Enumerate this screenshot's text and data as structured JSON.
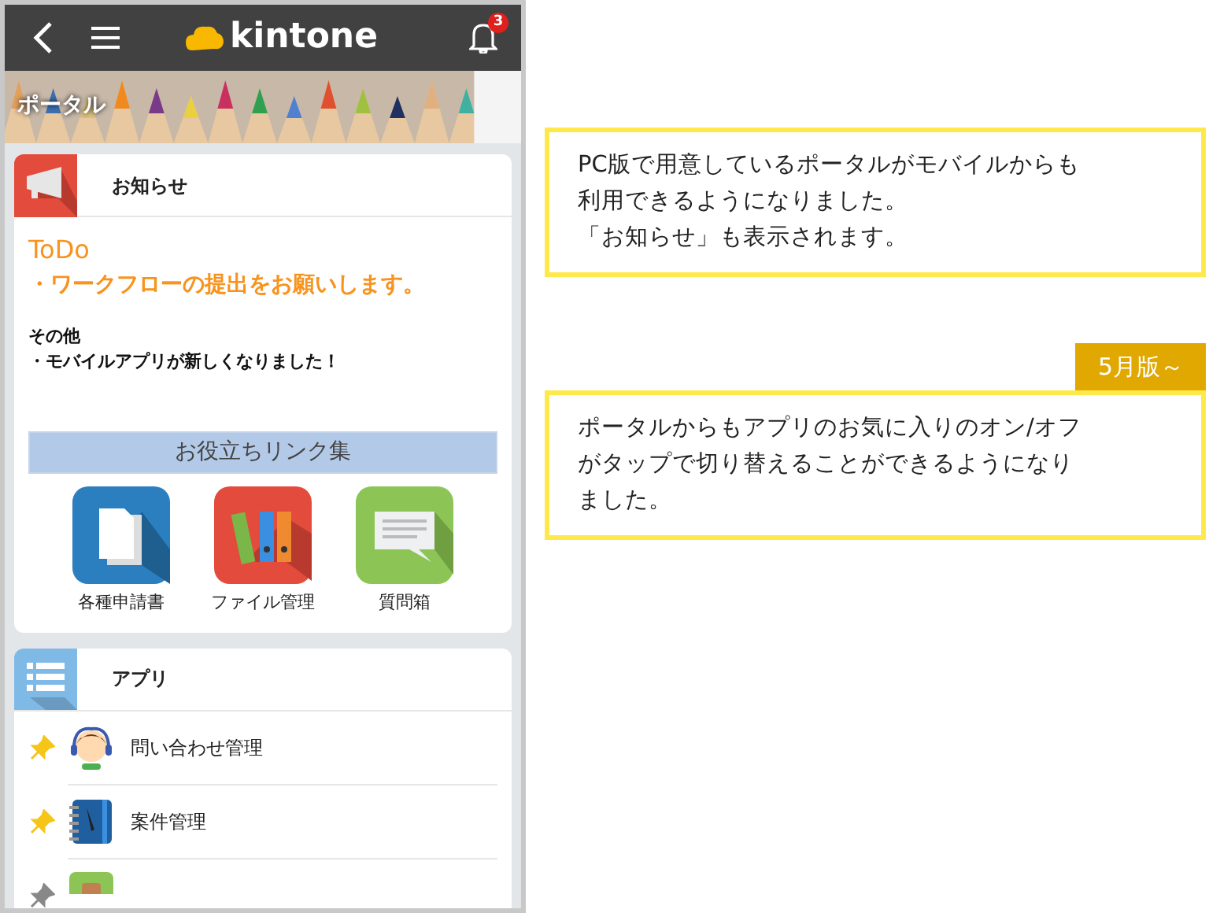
{
  "header": {
    "logo": "kintone",
    "notification_count": "3"
  },
  "banner": {
    "title": "ポータル"
  },
  "notice": {
    "title": "お知らせ",
    "todo_heading": "ToDo",
    "todo_item": "・ワークフローの提出をお願いします。",
    "other_heading": "その他",
    "other_item": "・モバイルアプリが新しくなりました！"
  },
  "links": {
    "title": "お役立ちリンク集",
    "items": [
      {
        "kind": "documents",
        "label": "各種申請書"
      },
      {
        "kind": "files",
        "label": "ファイル管理"
      },
      {
        "kind": "chat",
        "label": "質問箱"
      }
    ]
  },
  "apps": {
    "title": "アプリ",
    "items": [
      {
        "kind": "person",
        "label": "問い合わせ管理",
        "pinned": true
      },
      {
        "kind": "notebook",
        "label": "案件管理",
        "pinned": true
      },
      {
        "kind": "bag",
        "pinned": false
      }
    ]
  },
  "callouts": [
    {
      "lines": [
        "PC版で用意しているポータルがモバイルからも",
        "利用できるようになりました。",
        "「お知らせ」も表示されます。"
      ]
    },
    {
      "badge": "5月版～",
      "lines": [
        "ポータルからもアプリのお気に入りのオン/オフ",
        "がタップで切り替えることができるようになり",
        "ました。"
      ]
    }
  ]
}
